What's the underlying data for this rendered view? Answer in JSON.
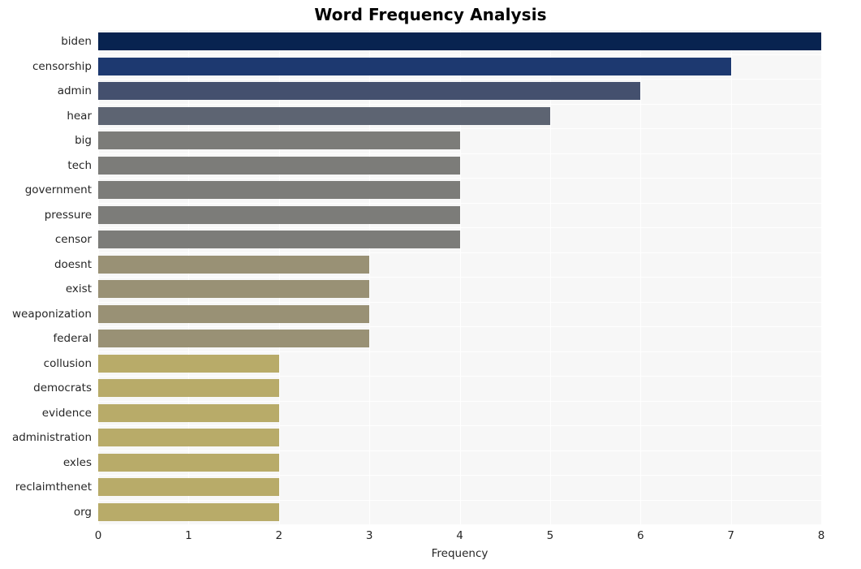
{
  "chart_data": {
    "type": "bar",
    "orientation": "horizontal",
    "title": "Word Frequency Analysis",
    "xlabel": "Frequency",
    "ylabel": "",
    "xlim": [
      0,
      8
    ],
    "xticks": [
      "0",
      "1",
      "2",
      "3",
      "4",
      "5",
      "6",
      "7",
      "8"
    ],
    "grid": true,
    "legend": "none",
    "categories": [
      "biden",
      "censorship",
      "admin",
      "hear",
      "big",
      "tech",
      "government",
      "pressure",
      "censor",
      "doesnt",
      "exist",
      "weaponization",
      "federal",
      "collusion",
      "democrats",
      "evidence",
      "administration",
      "exles",
      "reclaimthenet",
      "org"
    ],
    "values": [
      8,
      7,
      6,
      5,
      4,
      4,
      4,
      4,
      4,
      3,
      3,
      3,
      3,
      2,
      2,
      2,
      2,
      2,
      2,
      2
    ],
    "bar_colors": [
      "#082350",
      "#1d3970",
      "#44506e",
      "#5d6472",
      "#7c7c79",
      "#7c7c79",
      "#7c7c79",
      "#7c7c79",
      "#7c7c79",
      "#999175",
      "#999175",
      "#999175",
      "#999175",
      "#b8ab69",
      "#b8ab69",
      "#b8ab69",
      "#b8ab69",
      "#b8ab69",
      "#b8ab69",
      "#b8ab69"
    ],
    "plot_background": "#f7f7f7",
    "grid_color": "#ffffff",
    "figure_background": "#ffffff",
    "text_color": "#262626"
  }
}
